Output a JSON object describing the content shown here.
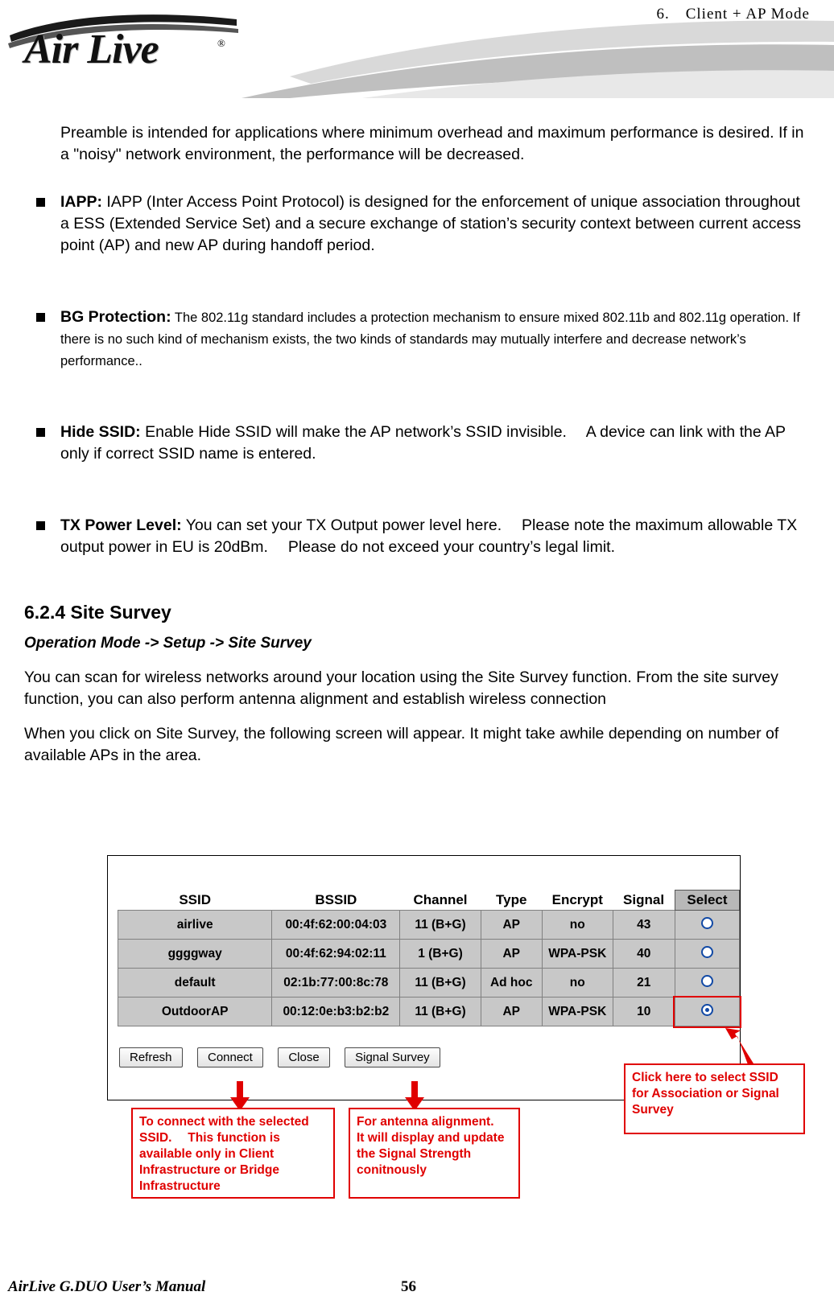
{
  "header": {
    "chapter_title": "6.　Client + AP Mode",
    "logo_text": "Air Live",
    "logo_reg": "®"
  },
  "body": {
    "intro_paragraph": "Preamble is intended for applications where minimum overhead and maximum performance is desired. If in a \"noisy\" network environment, the performance will be decreased.",
    "bullets": [
      {
        "term": "IAPP:",
        "text": "  IAPP (Inter Access Point Protocol) is designed for the enforcement of unique association throughout a ESS (Extended Service Set) and a secure exchange of station’s security context between current access point (AP) and new AP during handoff period.",
        "small": false
      },
      {
        "term": "BG Protection:",
        "text": "  The 802.11g standard includes a protection mechanism to ensure mixed 802.11b and 802.11g operation. If there is no such kind of mechanism exists, the two kinds of standards may mutually interfere and decrease network’s performance..",
        "small": true
      },
      {
        "term": "Hide SSID:",
        "text": "  Enable Hide SSID will make the AP network’s SSID invisible.　 A device can link with the AP only if correct SSID name is entered.",
        "small": false
      },
      {
        "term": "TX Power Level:",
        "text": "  You can set your TX Output power level here.　 Please note the maximum allowable TX output power in EU is 20dBm.　 Please do not exceed your country’s legal limit.",
        "small": false
      }
    ],
    "section_number_title": "6.2.4 Site Survey",
    "breadcrumb": "Operation Mode -> Setup -> Site Survey",
    "paragraph_1": "You can scan for wireless networks around your location using the Site Survey function. From the site survey function, you can also perform antenna alignment and establish wireless connection",
    "paragraph_2": "When you click on Site Survey, the following screen will appear. It might take awhile depending on number of available APs in the area."
  },
  "site_survey": {
    "columns": [
      "SSID",
      "BSSID",
      "Channel",
      "Type",
      "Encrypt",
      "Signal",
      "Select"
    ],
    "rows": [
      {
        "ssid": "airlive",
        "bssid": "00:4f:62:00:04:03",
        "channel": "11 (B+G)",
        "type": "AP",
        "encrypt": "no",
        "signal": "43",
        "selected": false
      },
      {
        "ssid": "ggggway",
        "bssid": "00:4f:62:94:02:11",
        "channel": "1 (B+G)",
        "type": "AP",
        "encrypt": "WPA-PSK",
        "signal": "40",
        "selected": false
      },
      {
        "ssid": "default",
        "bssid": "02:1b:77:00:8c:78",
        "channel": "11 (B+G)",
        "type": "Ad hoc",
        "encrypt": "no",
        "signal": "21",
        "selected": false
      },
      {
        "ssid": "OutdoorAP",
        "bssid": "00:12:0e:b3:b2:b2",
        "channel": "11 (B+G)",
        "type": "AP",
        "encrypt": "WPA-PSK",
        "signal": "10",
        "selected": true
      }
    ],
    "buttons": [
      "Refresh",
      "Connect",
      "Close",
      "Signal Survey"
    ]
  },
  "callouts": {
    "connect": "To connect with the selected SSID.　 This function is available only in Client Infrastructure or Bridge Infrastructure",
    "antenna": "For antenna alignment.　 It will display and update the Signal Strength conitnously",
    "select": "Click here to select SSID for Association or Signal Survey"
  },
  "footer": {
    "manual_title": "AirLive G.DUO User’s Manual",
    "page_number": "56"
  },
  "colors": {
    "callout_red": "#e00000",
    "table_row_gray": "#c8c8c8",
    "select_header_gray": "#b8b8b8"
  }
}
